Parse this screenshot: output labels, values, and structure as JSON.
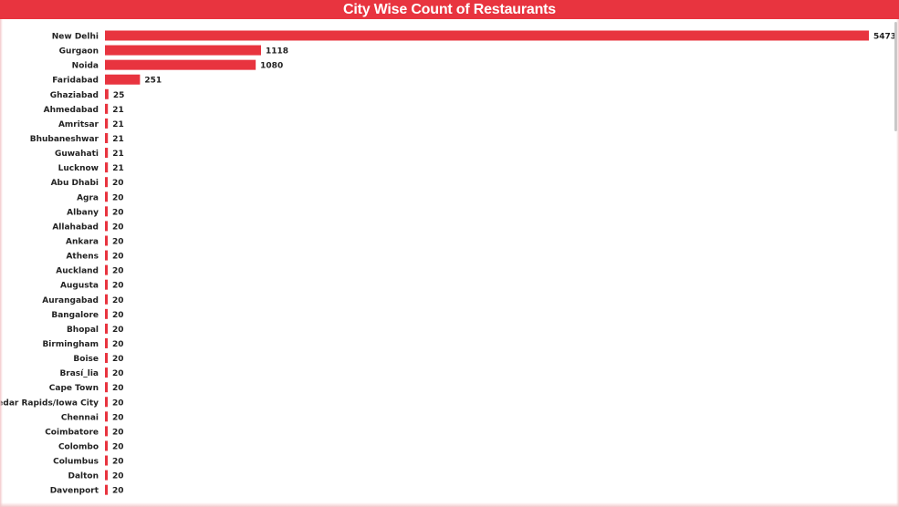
{
  "colors": {
    "accent": "#e8343f",
    "bar": "#e8343f",
    "title_text": "#ffffff",
    "label_text": "#222222"
  },
  "chart_data": {
    "type": "bar",
    "orientation": "horizontal",
    "title": "City Wise Count of Restaurants",
    "xlabel": "",
    "ylabel": "",
    "grid": false,
    "data_labels": true,
    "categories": [
      "New Delhi",
      "Gurgaon",
      "Noida",
      "Faridabad",
      "Ghaziabad",
      "Ahmedabad",
      "Amritsar",
      "Bhubaneshwar",
      "Guwahati",
      "Lucknow",
      "Abu Dhabi",
      "Agra",
      "Albany",
      "Allahabad",
      "Ankara",
      "Athens",
      "Auckland",
      "Augusta",
      "Aurangabad",
      "Bangalore",
      "Bhopal",
      "Birmingham",
      "Boise",
      "Brasí_lia",
      "Cape Town",
      "Cedar Rapids/Iowa City",
      "Chennai",
      "Coimbatore",
      "Colombo",
      "Columbus",
      "Dalton",
      "Davenport"
    ],
    "values": [
      5473,
      1118,
      1080,
      251,
      25,
      21,
      21,
      21,
      21,
      21,
      20,
      20,
      20,
      20,
      20,
      20,
      20,
      20,
      20,
      20,
      20,
      20,
      20,
      20,
      20,
      20,
      20,
      20,
      20,
      20,
      20,
      20
    ],
    "xlim": [
      0,
      5473
    ]
  }
}
